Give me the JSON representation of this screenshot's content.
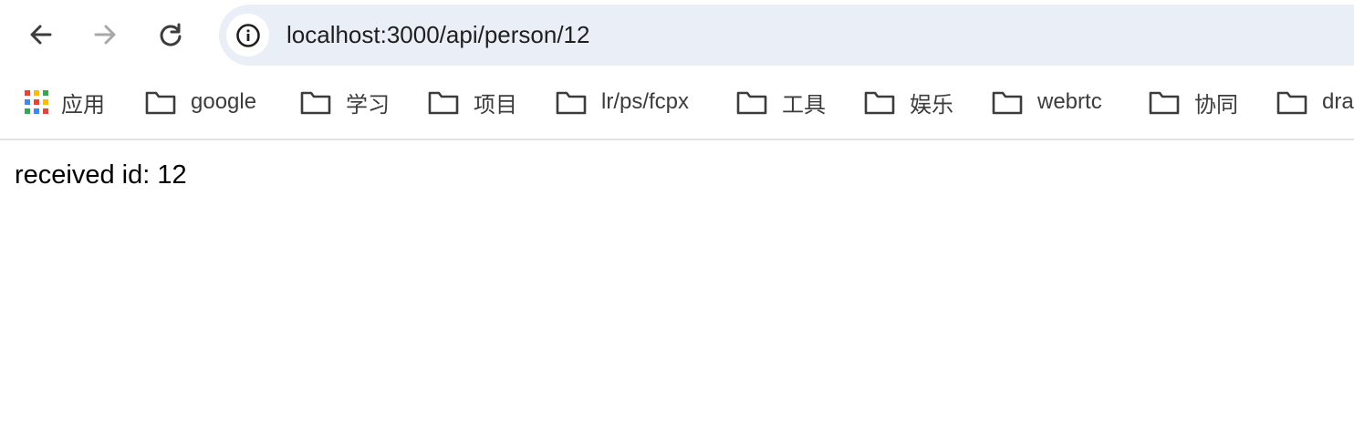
{
  "toolbar": {
    "back_icon": "arrow-left-icon",
    "forward_icon": "arrow-right-icon",
    "reload_icon": "reload-icon",
    "site_info_icon": "info-circle-icon",
    "url": "localhost:3000/api/person/12"
  },
  "bookmarks": {
    "apps_label": "应用",
    "items": [
      {
        "label": "google"
      },
      {
        "label": "学习"
      },
      {
        "label": "项目"
      },
      {
        "label": "lr/ps/fcpx"
      },
      {
        "label": "工具"
      },
      {
        "label": "娱乐"
      },
      {
        "label": "webrtc"
      },
      {
        "label": "协同"
      },
      {
        "label": "dra"
      }
    ]
  },
  "page": {
    "text": "received id: 12"
  },
  "colors": {
    "omnibox_bg": "#eaeef6",
    "icon_active": "#3c3c3c",
    "icon_disabled": "#a8a8a8",
    "apps_grid": [
      "#ea4335",
      "#fbbc04",
      "#34a853",
      "#4285f4",
      "#ea4335",
      "#fbbc04",
      "#34a853",
      "#4285f4",
      "#ea4335"
    ]
  }
}
